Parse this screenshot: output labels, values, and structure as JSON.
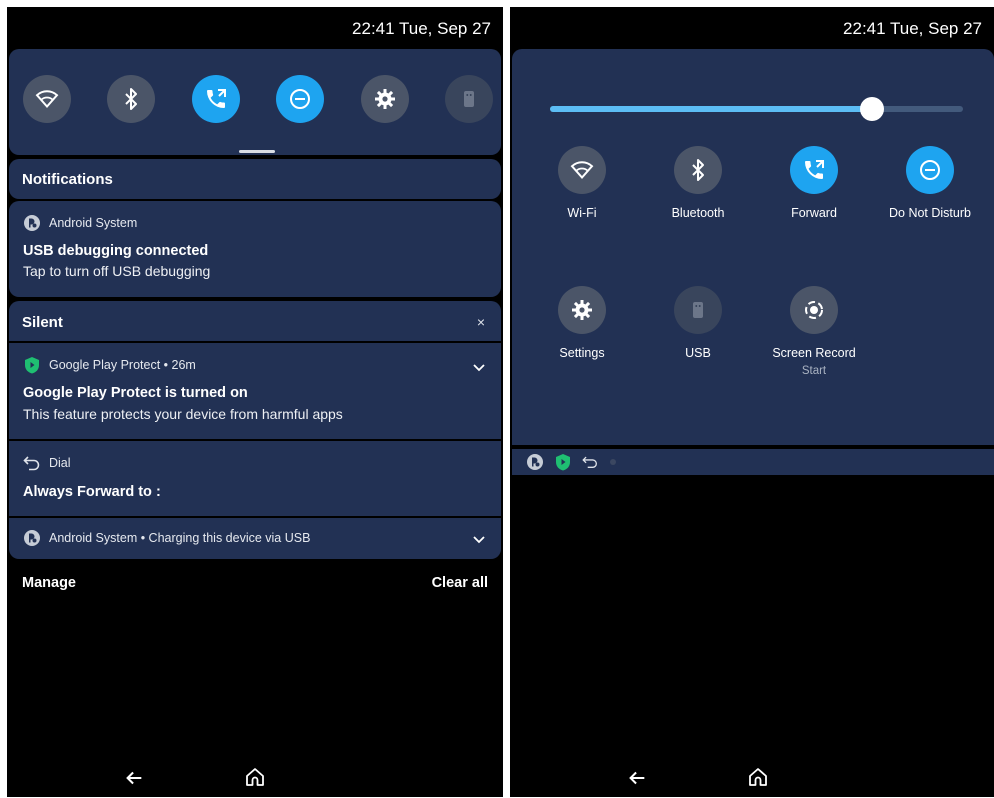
{
  "left": {
    "status_time": "22:41 Tue, Sep 27",
    "quick_settings": [
      "wifi-icon",
      "bluetooth-icon",
      "forward-call-icon",
      "do-not-disturb-icon",
      "settings-gear-icon",
      "usb-icon"
    ],
    "notifications_header": "Notifications",
    "usb_notif": {
      "app": "Android System",
      "title": "USB debugging connected",
      "text": "Tap to turn off USB debugging"
    },
    "silent_header": "Silent",
    "silent_close": "×",
    "play_protect": {
      "app": "Google Play Protect • 26m",
      "title": "Google Play Protect is turned on",
      "text": "This feature protects your device from harmful apps"
    },
    "dial": {
      "app": "Dial",
      "title": "Always Forward to :"
    },
    "charging": {
      "app": "Android System • Charging this device via USB"
    },
    "manage_label": "Manage",
    "clear_all_label": "Clear all"
  },
  "right": {
    "status_time": "22:41 Tue, Sep 27",
    "brightness_level": 0.78,
    "tiles": [
      {
        "label": "Wi-Fi",
        "icon": "wifi-icon",
        "state": "off"
      },
      {
        "label": "Bluetooth",
        "icon": "bluetooth-icon",
        "state": "off"
      },
      {
        "label": "Forward",
        "icon": "forward-call-icon",
        "state": "on"
      },
      {
        "label": "Do Not Disturb",
        "icon": "do-not-disturb-icon",
        "state": "on"
      },
      {
        "label": "Settings",
        "icon": "settings-gear-icon",
        "state": "off"
      },
      {
        "label": "USB",
        "icon": "usb-icon",
        "state": "unavailable"
      },
      {
        "label": "Screen Record",
        "sublabel": "Start",
        "icon": "screen-record-icon",
        "state": "off"
      }
    ]
  },
  "colors": {
    "panel": "#223154",
    "active": "#1ea4f0",
    "inactive": "#4b5568",
    "slider": "#5cbdf5"
  }
}
